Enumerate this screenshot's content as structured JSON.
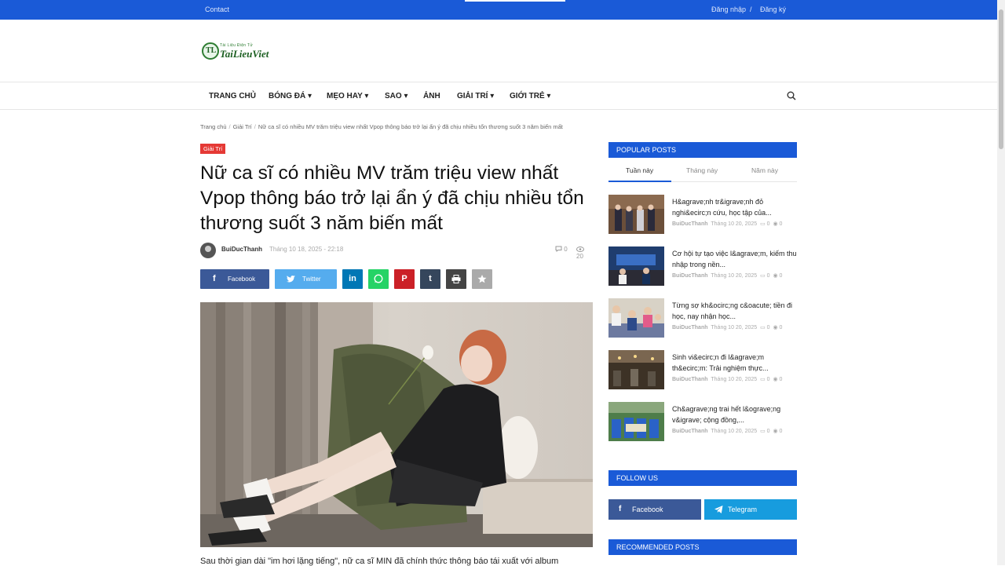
{
  "topbar": {
    "contact": "Contact",
    "login": "Đăng nhập",
    "slash": "/",
    "register": "Đăng ký"
  },
  "logo": {
    "small": "Tài Liệu Điện Tử",
    "big": "TaiLieuViet",
    "mark": "TL"
  },
  "nav": {
    "items": [
      "TRANG CHỦ",
      "BÓNG ĐÁ ▾",
      "MẸO HAY ▾",
      "SAO ▾",
      "ẢNH",
      "GIẢI TRÍ ▾",
      "GIỚI TRẺ ▾"
    ],
    "search_icon": "search-icon"
  },
  "breadcrumb": {
    "home": "Trang chủ",
    "category": "Giải Trí",
    "current": "Nữ ca sĩ có nhiều MV trăm triệu view nhất Vpop thông báo trở lại ẩn ý đã chịu nhiều tổn thương suốt 3 năm biến mất",
    "sep": "/"
  },
  "article": {
    "category": "Giải Trí",
    "title": "Nữ ca sĩ có nhiều MV trăm triệu view nhất Vpop thông báo trở lại ẩn ý đã chịu nhiều tổn thương suốt 3 năm biến mất",
    "author": "BuiDucThanh",
    "date": "Tháng 10 18, 2025 - 22:18",
    "comments": "0",
    "views": "20",
    "body_start": "Sau thời gian dài \"im hơi lặng tiếng\", nữ ca sĩ MIN đã chính thức thông báo tái xuất với album"
  },
  "share": {
    "facebook": "Facebook",
    "twitter": "Twitter",
    "colors": {
      "facebook": "#3b5998",
      "twitter": "#55acee",
      "linkedin": "#0077b5",
      "whatsapp": "#25d366",
      "pinterest": "#cb2027",
      "tumblr": "#35465c",
      "print": "#444444",
      "more": "#aaaaaa"
    }
  },
  "sidebar": {
    "popular_title": "POPULAR POSTS",
    "tabs": [
      "Tuần này",
      "Tháng này",
      "Năm này"
    ],
    "posts": [
      {
        "title": "H&agrave;nh tr&igrave;nh đỏ nghi&ecirc;n cứu, học tập của...",
        "author": "BuiDucThanh",
        "date": "Tháng 10 20, 2025",
        "comments": "0",
        "views": "0"
      },
      {
        "title": "Cơ hội tự tạo việc l&agrave;m, kiếm thu nhập trong nền...",
        "author": "BuiDucThanh",
        "date": "Tháng 10 20, 2025",
        "comments": "0",
        "views": "0"
      },
      {
        "title": "Từng sợ kh&ocirc;ng c&oacute; tiền đi học, nay nhận học...",
        "author": "BuiDucThanh",
        "date": "Tháng 10 20, 2025",
        "comments": "0",
        "views": "0"
      },
      {
        "title": "Sinh vi&ecirc;n đi l&agrave;m th&ecirc;m: Trải nghiệm thực...",
        "author": "BuiDucThanh",
        "date": "Tháng 10 20, 2025",
        "comments": "0",
        "views": "0"
      },
      {
        "title": "Ch&agrave;ng trai hết l&ograve;ng v&igrave; cộng đồng,...",
        "author": "BuiDucThanh",
        "date": "Tháng 10 20, 2025",
        "comments": "0",
        "views": "0"
      }
    ],
    "follow_title": "FOLLOW US",
    "follow": {
      "facebook": "Facebook",
      "telegram": "Telegram"
    },
    "recommended_title": "RECOMMENDED POSTS"
  }
}
